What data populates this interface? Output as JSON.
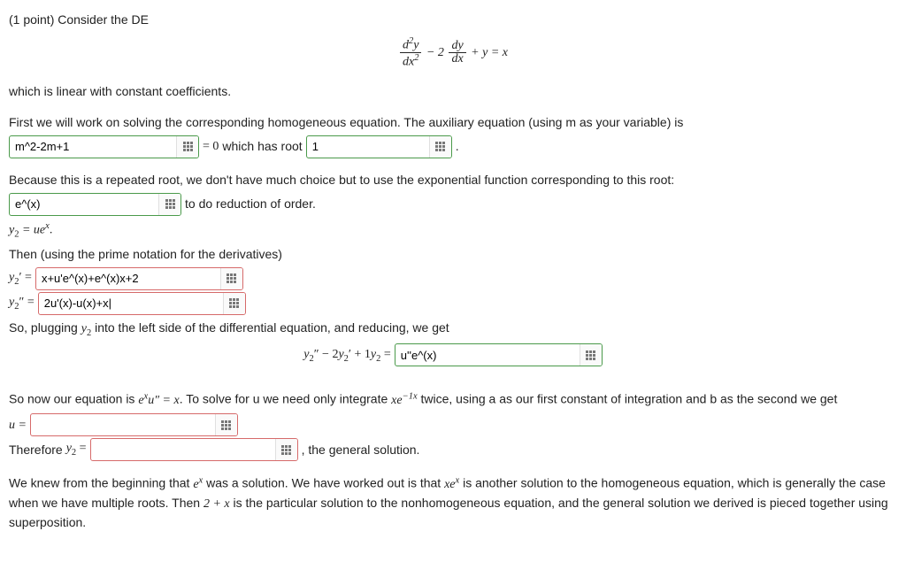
{
  "points_label": "(1 point)",
  "intro_1": "Consider the DE",
  "equation": {
    "d2y": "d",
    "sup2": "2",
    "y": "y",
    "dx2_top": "dx",
    "minus": " − 2",
    "dy": "dy",
    "dx": "dx",
    "plus_y": " + y = x"
  },
  "intro_2": "which is linear with constant coefficients.",
  "p_aux": "First we will work on solving the corresponding homogeneous equation. The auxiliary equation (using m as your variable) is",
  "aux_input": "m^2-2m+1",
  "aux_eq0": "= 0",
  "aux_has_root": "which has root",
  "aux_root_input": "1",
  "p_repeated": "Because this is a repeated root, we don't have much choice but to use the exponential function corresponding to this root:",
  "reduction_input": "e^(x)",
  "reduction_tail": "to do reduction of order.",
  "y2_eq_uex": "y",
  "y2_eq_uex_rhs": " = ue",
  "prime_note": "Then (using the prime notation for the derivatives)",
  "y2p_label_pre": "y",
  "y2p_label_eq": " = ",
  "y2p_input": "x+u'e^(x)+e^(x)x+2",
  "y2pp_input": "2u'(x)-u(x)+x|",
  "plug_text": "So, plugging ",
  "plug_y2": "y",
  "plug_tail": " into the left side of the differential equation, and reducing, we get",
  "lhs_reduced_pre_a": "y",
  "lhs_reduced_mid": " − 2",
  "lhs_reduced_plus": " + 1",
  "lhs_reduced_eq": " = ",
  "lhs_input": "u''e^(x)",
  "solve_u_1": "So now our equation is ",
  "solve_u_eq": "e",
  "solve_u_x": "x",
  "solve_u_upp": "u″ = x",
  "solve_u_2": ". To solve for u we need only integrate ",
  "xe": "xe",
  "neg1x": "−1x",
  "solve_u_3": " twice, using a as our first constant of integration and b as the second we get",
  "u_eq": "u = ",
  "u_input": "",
  "therefore": "Therefore ",
  "y2_eq": " = ",
  "y2_input": "",
  "general_sol": ", the general solution.",
  "final_1": "We knew from the beginning that ",
  "ex": "e",
  "final_2": " was a solution. We have worked out is that ",
  "xex_x": "xe",
  "final_3": " is another solution to the homogeneous equation, which is generally the case when we have multiple roots. Then ",
  "two_plus_x": "2 + x",
  "final_4": " is the particular solution to the nonhomogeneous equation, and the general solution we derived is pieced together using superposition."
}
